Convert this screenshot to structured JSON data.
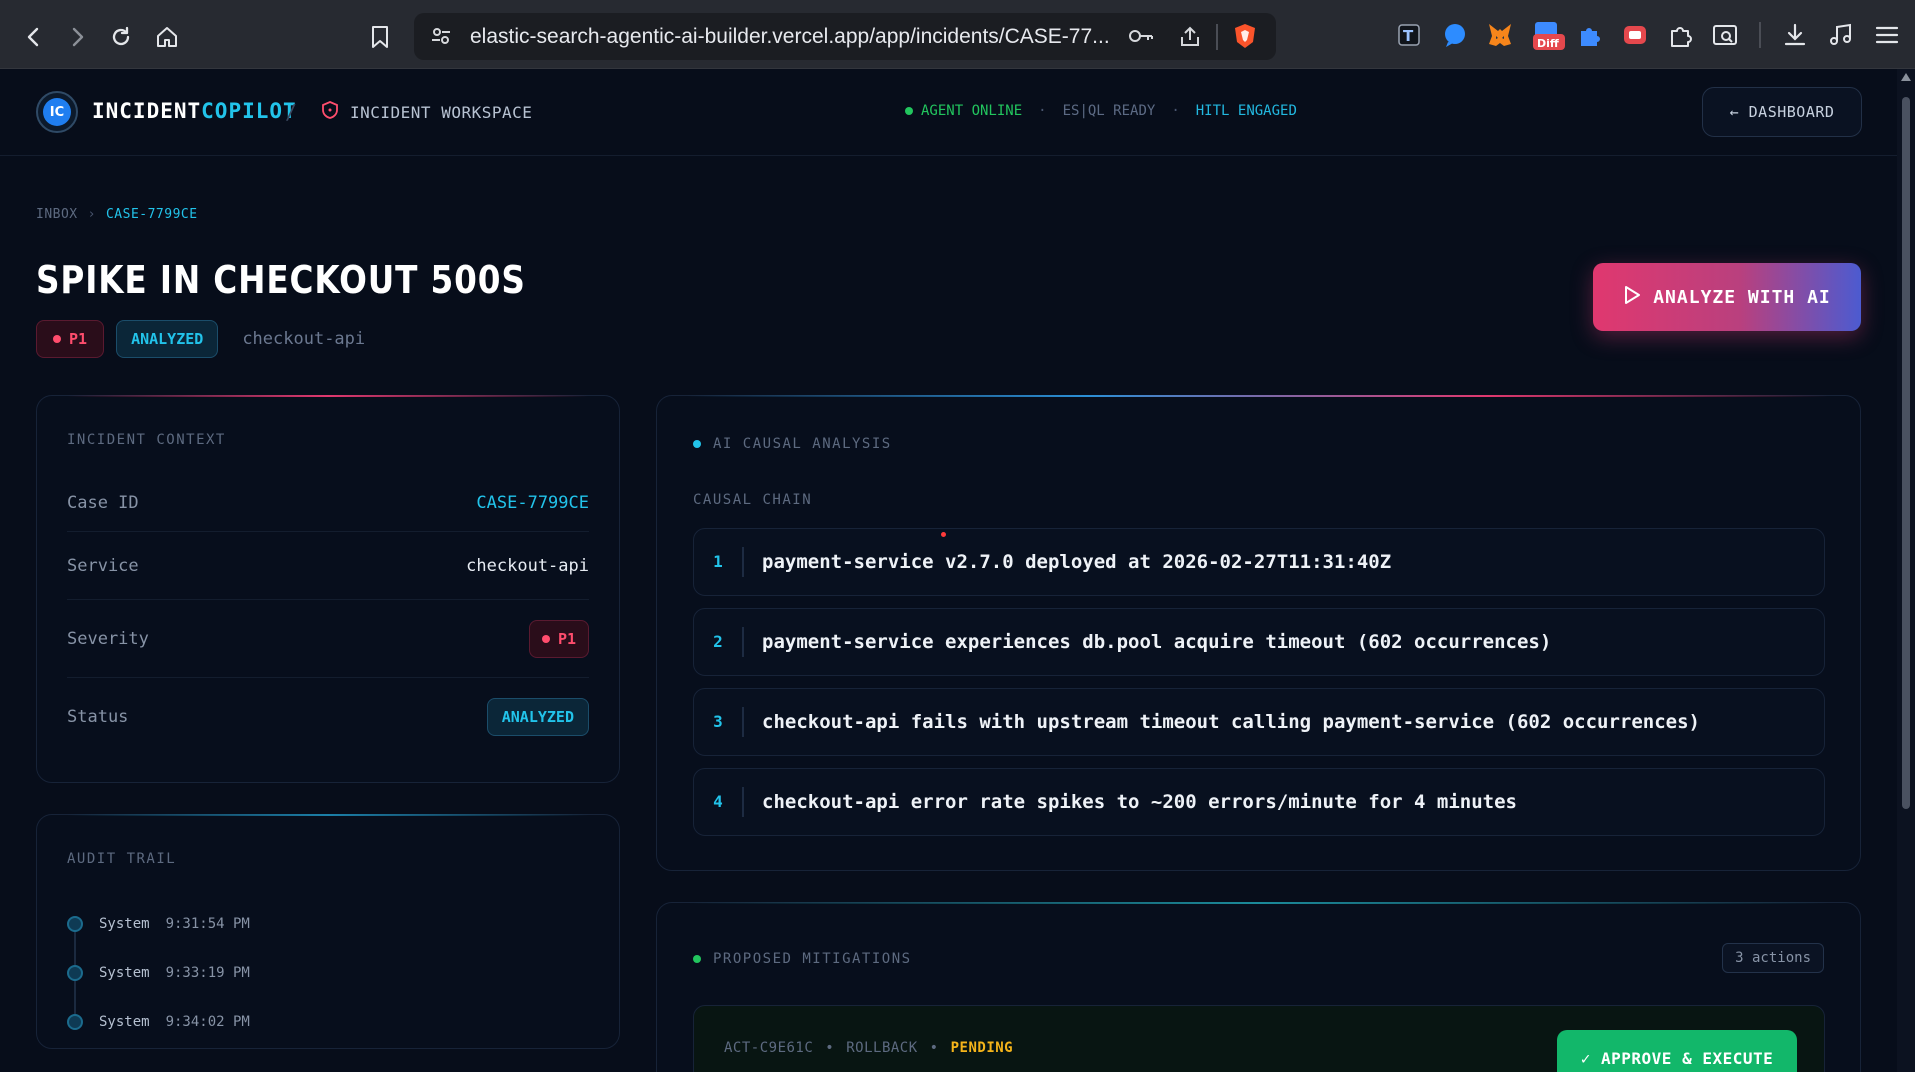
{
  "browser": {
    "url": "elastic-search-agentic-ai-builder.vercel.app/app/incidents/CASE-77...",
    "ext_badge": "Diff"
  },
  "header": {
    "logo_text": "IC",
    "brand_main": "INCIDENT",
    "brand_accent": "COPILOT",
    "separator": "/",
    "workspace": "INCIDENT WORKSPACE",
    "status": {
      "online": "AGENT ONLINE",
      "dot1": "·",
      "esql": "ES|QL READY",
      "dot2": "·",
      "hitl": "HITL ENGAGED"
    },
    "dashboard_button": "← DASHBOARD"
  },
  "breadcrumb": {
    "root": "INBOX",
    "chevron": "›",
    "current": "CASE-7799CE"
  },
  "incident": {
    "title": "SPIKE IN CHECKOUT 500S",
    "severity": "P1",
    "status": "ANALYZED",
    "service": "checkout-api"
  },
  "analyze_button": "ANALYZE WITH AI",
  "context": {
    "label": "INCIDENT CONTEXT",
    "rows": [
      {
        "key": "Case ID",
        "value": "CASE-7799CE"
      },
      {
        "key": "Service",
        "value": "checkout-api"
      },
      {
        "key": "Severity",
        "value": "P1"
      },
      {
        "key": "Status",
        "value": "ANALYZED"
      }
    ]
  },
  "audit": {
    "label": "AUDIT TRAIL",
    "entries": [
      {
        "who": "System",
        "time": "9:31:54 PM"
      },
      {
        "who": "System",
        "time": "9:33:19 PM"
      },
      {
        "who": "System",
        "time": "9:34:02 PM"
      }
    ]
  },
  "analysis": {
    "label": "AI CAUSAL ANALYSIS",
    "chain_label": "CAUSAL CHAIN",
    "steps": [
      {
        "n": "1",
        "text": "payment-service v2.7.0 deployed at 2026-02-27T11:31:40Z"
      },
      {
        "n": "2",
        "text": "payment-service experiences db.pool acquire timeout (602 occurrences)"
      },
      {
        "n": "3",
        "text": "checkout-api fails with upstream timeout calling payment-service (602 occurrences)"
      },
      {
        "n": "4",
        "text": "checkout-api error rate spikes to ~200 errors/minute for 4 minutes"
      }
    ]
  },
  "mitigations": {
    "label": "PROPOSED MITIGATIONS",
    "count": "3 actions",
    "first": {
      "id": "ACT-C9E61C",
      "dot1": "•",
      "type": "ROLLBACK",
      "dot2": "•",
      "state": "PENDING",
      "approve": "✓ APPROVE & EXECUTE"
    }
  },
  "colors": {
    "accent": "#22c3ea",
    "severity": "#ff4d6d",
    "online": "#22c55e",
    "pending": "#f5b41a",
    "approve": "#12b76a"
  }
}
